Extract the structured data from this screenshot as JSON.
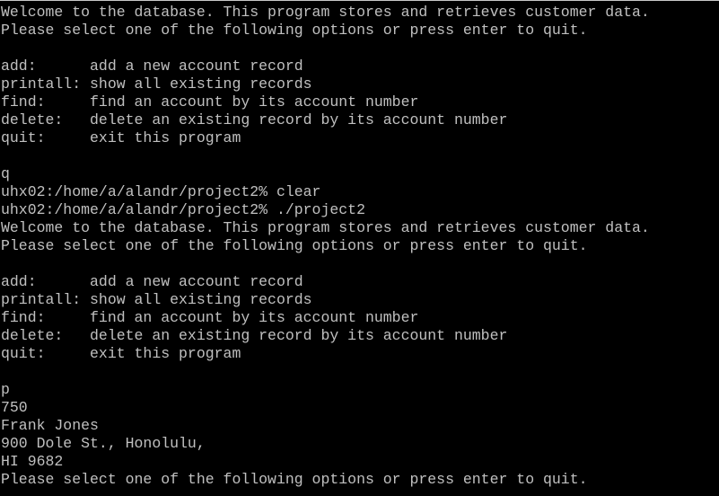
{
  "colors": {
    "background": "#000000",
    "text": "#c0c0c0"
  },
  "terminal": {
    "lines": [
      "Welcome to the database. This program stores and retrieves customer data.",
      "Please select one of the following options or press enter to quit.",
      "",
      "add:      add a new account record",
      "printall: show all existing records",
      "find:     find an account by its account number",
      "delete:   delete an existing record by its account number",
      "quit:     exit this program",
      "",
      "q",
      "uhx02:/home/a/alandr/project2% clear",
      "uhx02:/home/a/alandr/project2% ./project2",
      "Welcome to the database. This program stores and retrieves customer data.",
      "Please select one of the following options or press enter to quit.",
      "",
      "add:      add a new account record",
      "printall: show all existing records",
      "find:     find an account by its account number",
      "delete:   delete an existing record by its account number",
      "quit:     exit this program",
      "",
      "p",
      "750",
      "Frank Jones",
      "900 Dole St., Honolulu,",
      "HI 9682",
      "Please select one of the following options or press enter to quit."
    ]
  }
}
